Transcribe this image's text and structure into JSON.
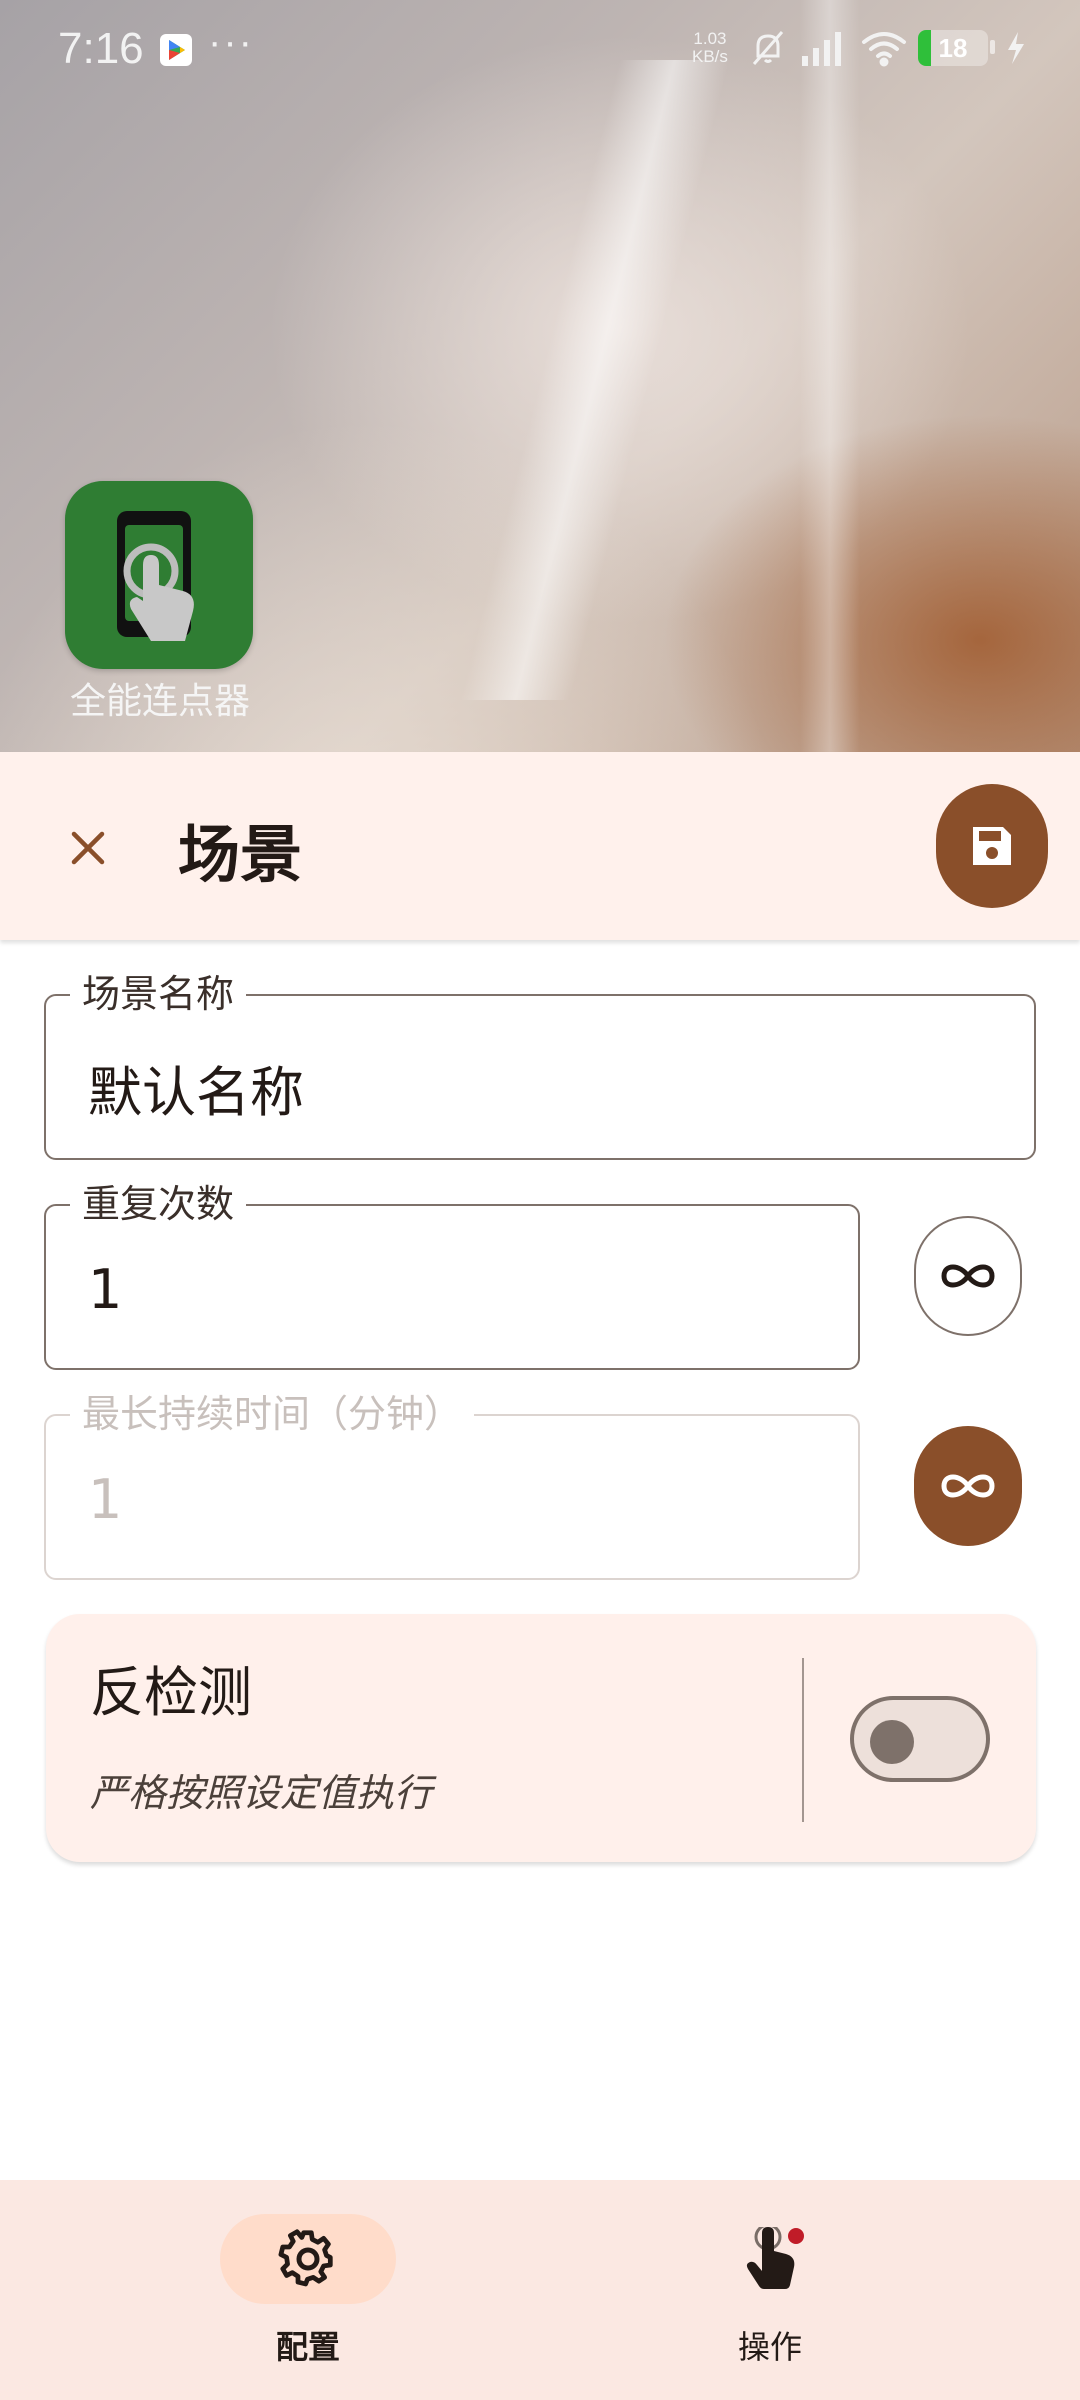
{
  "status_bar": {
    "time": "7:16",
    "more": "···",
    "net_speed_value": "1.03",
    "net_speed_unit": "KB/s",
    "battery_level": "18",
    "battery_fraction": 0.18
  },
  "home": {
    "app_label": "全能连点器"
  },
  "sheet": {
    "title": "场景",
    "close_icon": "close-icon",
    "save_icon": "save-icon"
  },
  "fields": {
    "scene_name": {
      "label": "场景名称",
      "value": "默认名称"
    },
    "repeat_count": {
      "label": "重复次数",
      "value": "1"
    },
    "max_duration": {
      "label": "最长持续时间（分钟）",
      "value": "1"
    }
  },
  "anti_detection": {
    "title": "反检测",
    "description": "严格按照设定值执行",
    "enabled": false
  },
  "bottom_nav": {
    "items": [
      {
        "label": "配置",
        "icon": "gear-icon",
        "active": true
      },
      {
        "label": "操作",
        "icon": "tap-icon",
        "active": false
      }
    ]
  },
  "colors": {
    "accent": "#8a4f2a",
    "surface": "#fff1ec",
    "nav_active": "#ffdcca",
    "badge": "#c01c28"
  }
}
